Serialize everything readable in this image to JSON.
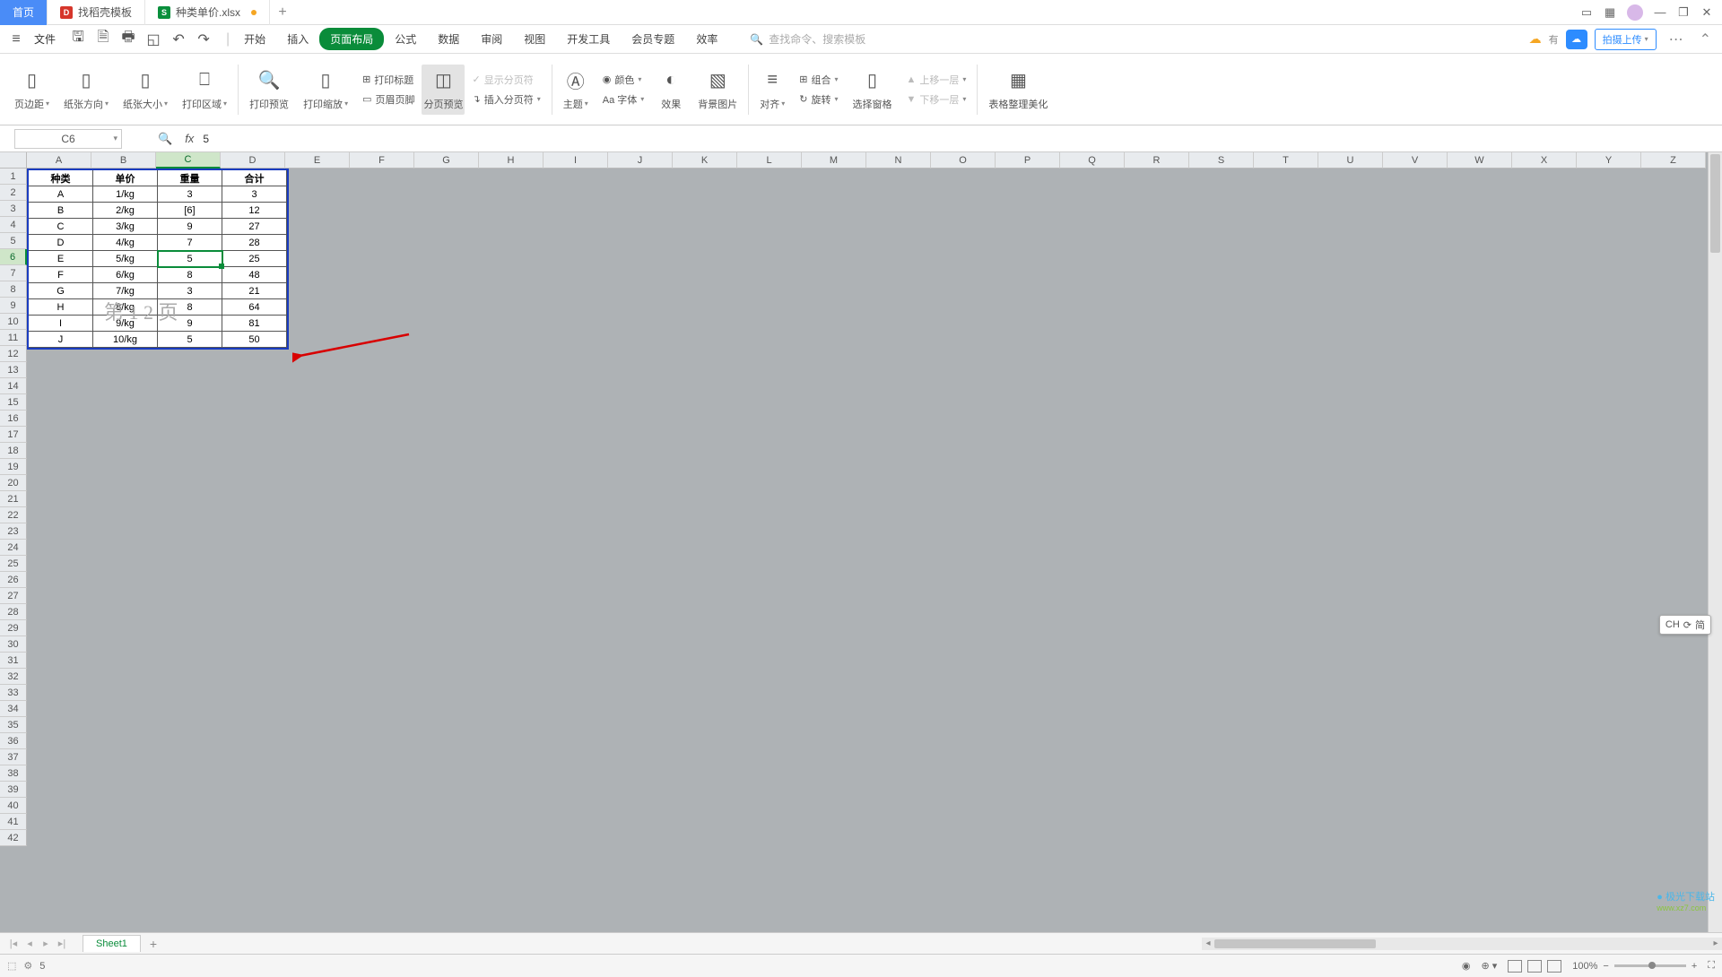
{
  "titlebar": {
    "tab_home": "首页",
    "tab_templates": "找稻壳模板",
    "tab_file": "种类单价.xlsx"
  },
  "file_menu": {
    "label": "文件"
  },
  "menu": {
    "start": "开始",
    "insert": "插入",
    "page_layout": "页面布局",
    "formula": "公式",
    "data": "数据",
    "review": "审阅",
    "view": "视图",
    "dev": "开发工具",
    "member": "会员专题",
    "efficiency": "效率"
  },
  "search": {
    "placeholder": "查找命令、搜索模板"
  },
  "top_right": {
    "sync_prefix": "有",
    "upload": "拍摄上传"
  },
  "ribbon": {
    "margin": "页边距",
    "orientation": "纸张方向",
    "size": "纸张大小",
    "print_area": "打印区域",
    "print_preview": "打印预览",
    "print_scale": "打印缩放",
    "print_titles": "打印标题",
    "header_footer": "页眉页脚",
    "page_break_preview": "分页预览",
    "show_breaks": "显示分页符",
    "insert_break": "插入分页符",
    "themes": "主题",
    "colors": "颜色",
    "fonts": "Aa 字体",
    "effects": "效果",
    "bg_image": "背景图片",
    "align": "对齐",
    "rotate": "旋转",
    "group": "组合",
    "send_up": "上移一层",
    "send_down": "下移一层",
    "selection_pane": "选择窗格",
    "table_beautify": "表格整理美化"
  },
  "namebox": {
    "ref": "C6"
  },
  "formula": {
    "value": "5"
  },
  "columns": [
    "A",
    "B",
    "C",
    "D",
    "E",
    "F",
    "G",
    "H",
    "I",
    "J",
    "K",
    "L",
    "M",
    "N",
    "O",
    "P",
    "Q",
    "R",
    "S",
    "T",
    "U",
    "V",
    "W",
    "X",
    "Y",
    "Z"
  ],
  "row_count": 42,
  "active": {
    "row": 6,
    "col": 3
  },
  "table": {
    "headers": [
      "种类",
      "单价",
      "重量",
      "合计"
    ],
    "rows": [
      [
        "A",
        "1/kg",
        "3",
        "3"
      ],
      [
        "B",
        "2/kg",
        "[6]",
        "12"
      ],
      [
        "C",
        "3/kg",
        "9",
        "27"
      ],
      [
        "D",
        "4/kg",
        "7",
        "28"
      ],
      [
        "E",
        "5/kg",
        "5",
        "25"
      ],
      [
        "F",
        "6/kg",
        "8",
        "48"
      ],
      [
        "G",
        "7/kg",
        "3",
        "21"
      ],
      [
        "H",
        "8/kg",
        "8",
        "64"
      ],
      [
        "I",
        "9/kg",
        "9",
        "81"
      ],
      [
        "J",
        "10/kg",
        "5",
        "50"
      ]
    ]
  },
  "watermark": "第 1 2 页",
  "ime": {
    "lang": "CH",
    "mode": "简"
  },
  "sheet_tabs": {
    "sheet1": "Sheet1"
  },
  "statusbar": {
    "value": "5",
    "zoom": "100%"
  },
  "logo": {
    "name": "极光下载站",
    "url": "www.xz7.com"
  }
}
